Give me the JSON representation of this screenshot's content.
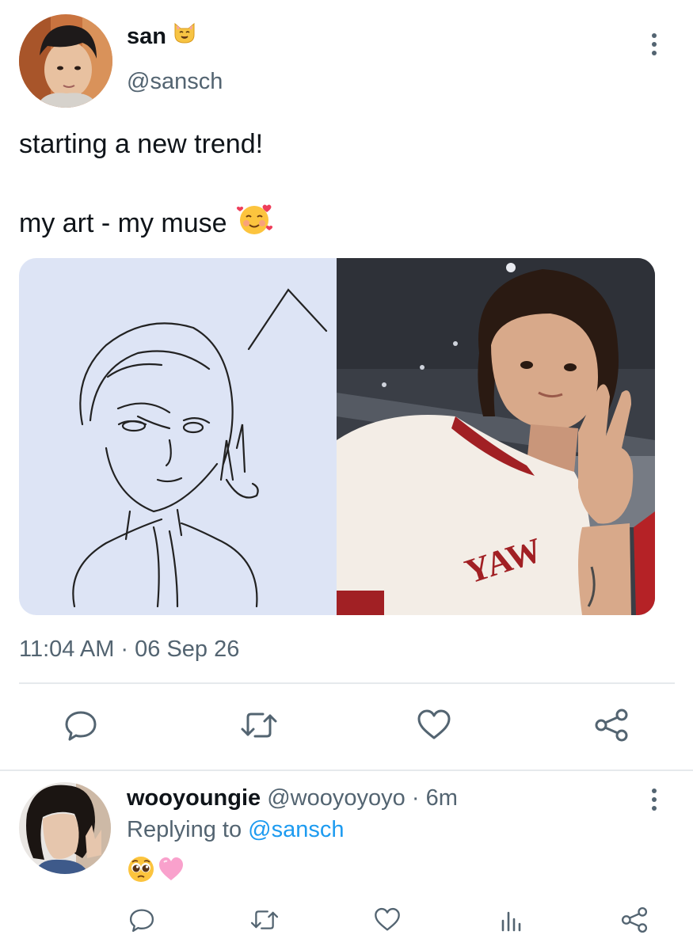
{
  "tweet": {
    "display_name": "san",
    "name_emoji": "cat-face-emoji",
    "handle": "@sansch",
    "text_line1": "starting a new trend!",
    "text_line2": "my art - my muse",
    "text_emoji": "smiling-face-with-hearts-emoji",
    "media": [
      {
        "name": "sketch-drawing-image",
        "description_text": ""
      },
      {
        "name": "selfie-photo-image",
        "description_text": ""
      }
    ],
    "timestamp": "11:04 AM · 06 Sep 26",
    "actions": [
      {
        "name": "reply-button",
        "icon": "comment-icon"
      },
      {
        "name": "retweet-button",
        "icon": "retweet-icon"
      },
      {
        "name": "like-button",
        "icon": "heart-icon"
      },
      {
        "name": "share-button",
        "icon": "share-icon"
      }
    ]
  },
  "reply": {
    "display_name": "wooyoungie",
    "handle": "@wooyoyoyo",
    "separator": "·",
    "time": "6m",
    "replying_prefix": "Replying to",
    "replying_handle": "@sansch",
    "emojis": [
      "pleading-face-emoji",
      "pink-heart-emoji"
    ],
    "actions": [
      {
        "name": "reply-button",
        "icon": "comment-icon"
      },
      {
        "name": "retweet-button",
        "icon": "retweet-icon"
      },
      {
        "name": "like-button",
        "icon": "heart-icon"
      },
      {
        "name": "analytics-button",
        "icon": "bar-chart-icon"
      },
      {
        "name": "share-button",
        "icon": "share-icon"
      }
    ]
  },
  "colors": {
    "text_primary": "#0f1419",
    "text_secondary": "#536471",
    "link": "#1d9bf0",
    "divider": "#e6e9ec",
    "icon": "#536471"
  }
}
